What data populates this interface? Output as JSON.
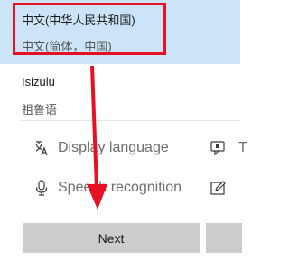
{
  "language_list": {
    "selected_item": {
      "name": "中文(中华人民共和国)",
      "subtitle": "中文(简体，中国)"
    },
    "items": [
      {
        "name": "Isizulu",
        "subtitle": "祖鲁语"
      }
    ]
  },
  "features": {
    "display_language": {
      "label": "Display language",
      "icon": "display-language-icon"
    },
    "speech_recognition": {
      "label": "Speech recognition",
      "icon": "microphone-icon"
    },
    "right_column": [
      {
        "label": "T",
        "icon": "text-to-speech-icon"
      },
      {
        "label": "",
        "icon": "handwriting-icon"
      }
    ]
  },
  "buttons": {
    "next_label": "Next"
  },
  "colors": {
    "selected_bg": "#cce4f7",
    "highlight_red": "#e81123",
    "button_bg": "#cccccc"
  }
}
